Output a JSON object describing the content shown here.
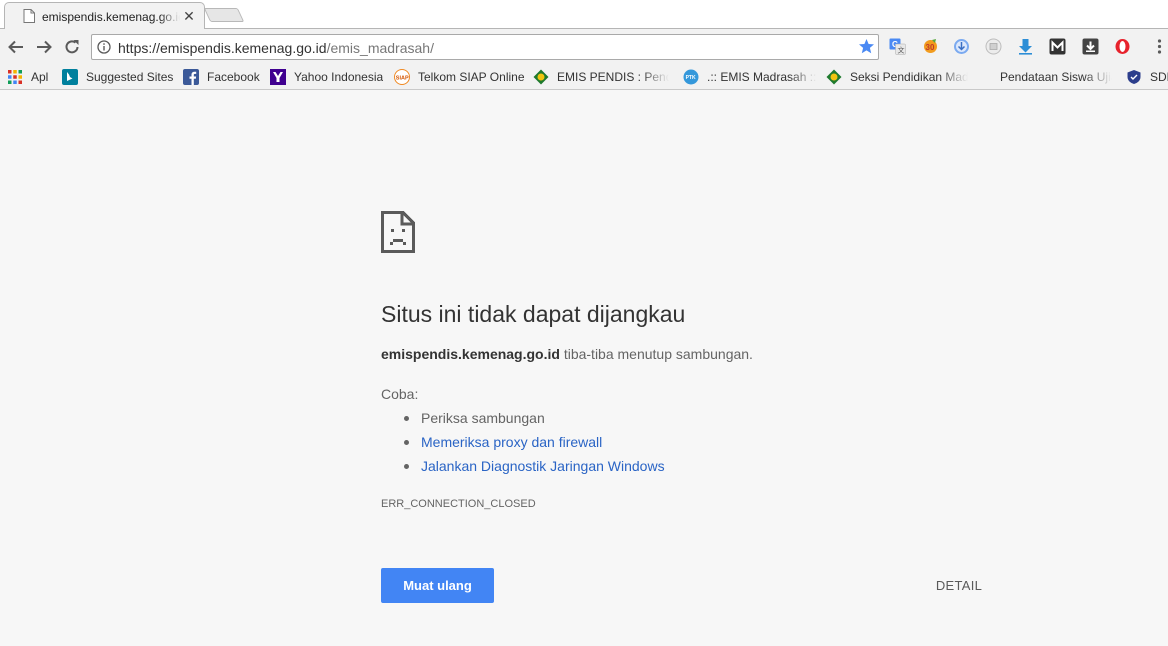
{
  "browser": {
    "tab": {
      "title": "emispendis.kemenag.go.id/emis_madrasah/",
      "close_glyph": "✕"
    },
    "address_bar": {
      "url_host": "https://emispendis.kemenag.go.id",
      "url_path": "/emis_madrasah/"
    },
    "nav_icons": [
      "back-arrow-icon",
      "forward-arrow-icon",
      "reload-icon"
    ],
    "extension_icons": [
      "google-translate-icon",
      "extension-orange-icon",
      "download-circle-icon",
      "extension-gray-icon",
      "download-arrow-icon",
      "m-logo-icon",
      "download-box-icon",
      "opera-icon",
      "chrome-menu-icon"
    ]
  },
  "bookmarks": [
    {
      "label": "Apl",
      "icon": "apps-grid-icon"
    },
    {
      "label": "Suggested Sites",
      "icon": "bing-icon"
    },
    {
      "label": "Facebook",
      "icon": "facebook-icon"
    },
    {
      "label": "Yahoo Indonesia",
      "icon": "yahoo-icon"
    },
    {
      "label": "Telkom SIAP Online",
      "icon": "siap-icon"
    },
    {
      "label": "EMIS PENDIS : Pendataan",
      "icon": "kemenag-icon"
    },
    {
      "label": ".:: EMIS Madrasah ::.",
      "icon": "ptk-icon"
    },
    {
      "label": "Seksi Pendidikan Madrasah",
      "icon": "kemenag-icon"
    },
    {
      "label": "Pendataan Siswa Ujian",
      "icon": "blank-icon"
    },
    {
      "label": "SDM",
      "icon": "shield-icon"
    }
  ],
  "error": {
    "heading": "Situs ini tidak dapat dijangkau",
    "host": "emispendis.kemenag.go.id",
    "summary_rest": " tiba-tiba menutup sambungan.",
    "try_label": "Coba:",
    "suggestions": [
      {
        "text": "Periksa sambungan",
        "link": false
      },
      {
        "text": "Memeriksa proxy dan firewall",
        "link": true
      },
      {
        "text": "Jalankan Diagnostik Jaringan Windows",
        "link": true
      }
    ],
    "code": "ERR_CONNECTION_CLOSED",
    "reload_label": "Muat ulang",
    "details_label": "DETAIL"
  },
  "colors": {
    "accent_button": "#4285f4",
    "link": "#2a64c5",
    "page_background": "#f7f7f7",
    "bookmark_star": "#4a89f3"
  }
}
